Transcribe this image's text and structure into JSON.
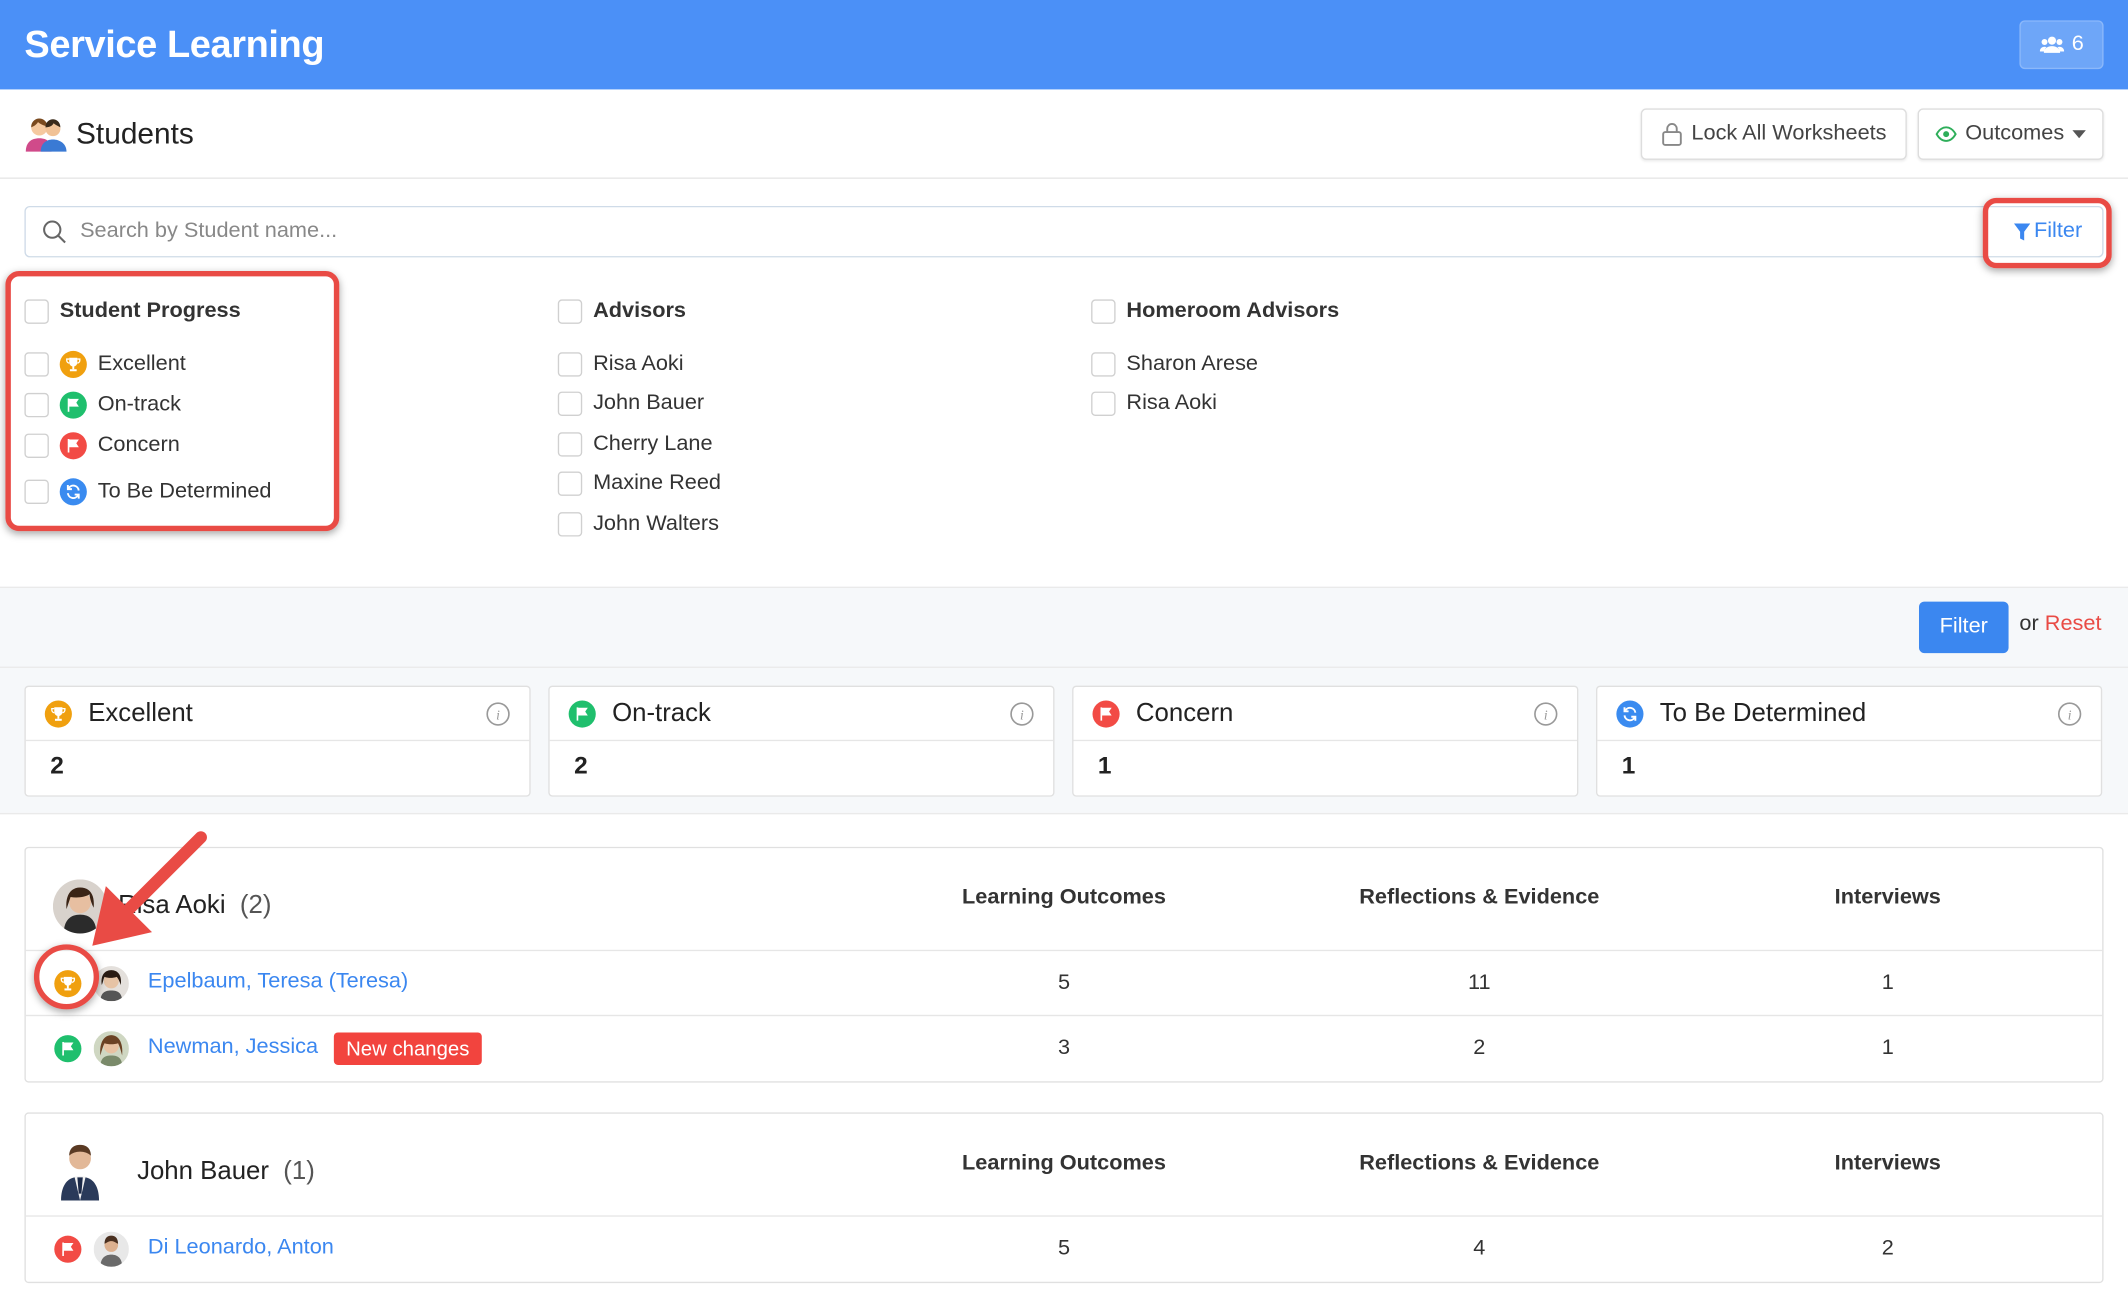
{
  "app": {
    "title": "Service Learning",
    "users_count": "6"
  },
  "header": {
    "title": "Students",
    "lock_label": "Lock All Worksheets",
    "outcomes_label": "Outcomes"
  },
  "search": {
    "placeholder": "Search by Student name...",
    "filter_label": "Filter"
  },
  "filters": {
    "progress": {
      "title": "Student Progress",
      "items": [
        "Excellent",
        "On-track",
        "Concern",
        "To Be Determined"
      ]
    },
    "advisors": {
      "title": "Advisors",
      "items": [
        "Risa Aoki",
        "John Bauer",
        "Cherry Lane",
        "Maxine Reed",
        "John Walters"
      ]
    },
    "homeroom": {
      "title": "Homeroom Advisors",
      "items": [
        "Sharon Arese",
        "Risa Aoki"
      ]
    }
  },
  "actions": {
    "filter_label": "Filter",
    "or": "or",
    "reset_label": "Reset"
  },
  "stats": [
    {
      "label": "Excellent",
      "value": "2",
      "color": "#f0a00f"
    },
    {
      "label": "On-track",
      "value": "2",
      "color": "#1fbf6d"
    },
    {
      "label": "Concern",
      "value": "1",
      "color": "#f24b45"
    },
    {
      "label": "To Be Determined",
      "value": "1",
      "color": "#3a8bf0"
    }
  ],
  "columns": {
    "outcomes": "Learning Outcomes",
    "reflections": "Reflections & Evidence",
    "interviews": "Interviews"
  },
  "groups": [
    {
      "advisor": "Risa Aoki",
      "count": "(2)",
      "students": [
        {
          "name": "Epelbaum, Teresa (Teresa)",
          "status": "excellent",
          "outcomes": "5",
          "reflections": "11",
          "interviews": "1"
        },
        {
          "name": "Newman, Jessica",
          "badge": "New changes",
          "status": "on-track",
          "outcomes": "3",
          "reflections": "2",
          "interviews": "1"
        }
      ]
    },
    {
      "advisor": "John Bauer",
      "count": "(1)",
      "students": [
        {
          "name": "Di Leonardo, Anton",
          "status": "concern",
          "outcomes": "5",
          "reflections": "4",
          "interviews": "2"
        }
      ]
    }
  ]
}
